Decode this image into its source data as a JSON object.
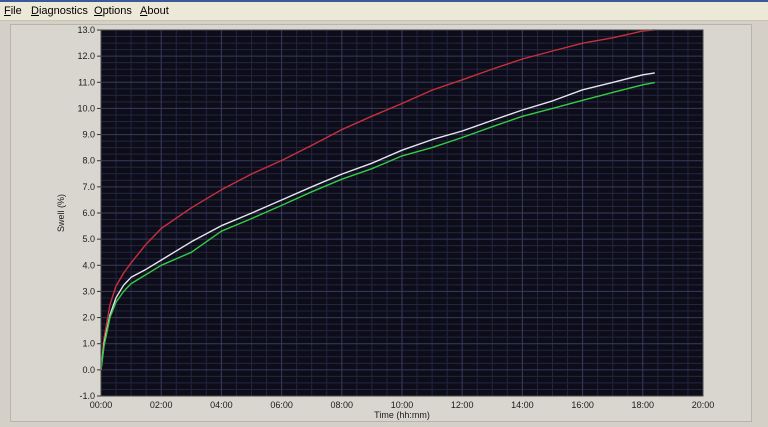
{
  "menubar": {
    "file": {
      "mnemonic": "F",
      "rest": "ile"
    },
    "diagnostics": {
      "mnemonic": "D",
      "rest": "iagnostics"
    },
    "options": {
      "mnemonic": "O",
      "rest": "ptions"
    },
    "about": {
      "mnemonic": "A",
      "rest": "bout"
    }
  },
  "chart_data": {
    "type": "line",
    "xlabel": "Time (hh:mm)",
    "ylabel": "Swell (%)",
    "x_unit": "hours",
    "xlim": [
      0,
      20
    ],
    "ylim": [
      -1.0,
      13.0
    ],
    "x_tick_labels": [
      "00:00",
      "02:00",
      "04:00",
      "06:00",
      "08:00",
      "10:00",
      "12:00",
      "14:00",
      "16:00",
      "18:00",
      "20:00"
    ],
    "y_tick_labels": [
      "-1.0",
      "0.0",
      "1.0",
      "2.0",
      "3.0",
      "4.0",
      "5.0",
      "6.0",
      "7.0",
      "8.0",
      "9.0",
      "10.0",
      "11.0",
      "12.0",
      "13.0"
    ],
    "grid": true,
    "background": "#0d0d1a",
    "grid_color": "#3a3a5e",
    "minor_grid_color": "#242440",
    "series": [
      {
        "color": "#c8303c",
        "x": [
          0,
          0.1,
          0.3,
          0.5,
          0.75,
          1,
          1.5,
          2,
          3,
          4,
          5,
          6,
          7,
          8,
          9,
          10,
          11,
          12,
          13,
          14,
          15,
          16,
          17,
          18,
          18.4
        ],
        "y": [
          0,
          1.2,
          2.5,
          3.2,
          3.7,
          4.1,
          4.8,
          5.4,
          6.2,
          6.9,
          7.5,
          8.0,
          8.6,
          9.2,
          9.7,
          10.2,
          10.7,
          11.1,
          11.5,
          11.9,
          12.2,
          12.5,
          12.7,
          12.95,
          13.0
        ]
      },
      {
        "color": "#e6e6f0",
        "x": [
          0,
          0.1,
          0.3,
          0.5,
          0.75,
          1,
          1.5,
          2,
          3,
          4,
          5,
          6,
          7,
          8,
          9,
          10,
          11,
          12,
          13,
          14,
          15,
          16,
          17,
          18,
          18.4
        ],
        "y": [
          0,
          1.0,
          2.1,
          2.75,
          3.25,
          3.55,
          3.85,
          4.2,
          4.9,
          5.5,
          6.0,
          6.5,
          7.0,
          7.5,
          7.9,
          8.4,
          8.8,
          9.15,
          9.55,
          9.95,
          10.3,
          10.7,
          11.0,
          11.3,
          11.35
        ]
      },
      {
        "color": "#33cc44",
        "x": [
          0,
          0.1,
          0.3,
          0.5,
          0.75,
          1,
          1.5,
          2,
          3,
          4,
          5,
          6,
          7,
          8,
          9,
          10,
          11,
          12,
          13,
          14,
          15,
          16,
          17,
          18,
          18.4
        ],
        "y": [
          0,
          0.9,
          2.0,
          2.6,
          3.0,
          3.3,
          3.65,
          4.0,
          4.5,
          5.3,
          5.8,
          6.3,
          6.8,
          7.3,
          7.7,
          8.2,
          8.5,
          8.9,
          9.3,
          9.7,
          10.0,
          10.3,
          10.6,
          10.9,
          11.0
        ]
      }
    ]
  }
}
